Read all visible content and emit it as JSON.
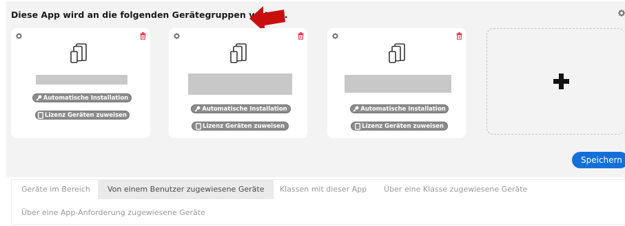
{
  "heading": "Diese App wird an die folgenden Gerätegruppen verteilt.",
  "icons": {
    "settings": "gear-icon",
    "delete": "trash-icon",
    "devices": "devices-icon",
    "key": "key-icon",
    "tablet": "tablet-icon",
    "add": "plus-icon",
    "annotation": "red-arrow"
  },
  "colors": {
    "panel_bg": "#f3f3f4",
    "pill_bg": "#8c8c8c",
    "trash": "#e8394c",
    "save": "#1470d8",
    "arrow": "#c80f0f"
  },
  "cards": [
    {
      "auto_install": "Automatische Installation",
      "assign_license": "Lizenz Geräten zuweisen"
    },
    {
      "auto_install": "Automatische Installation",
      "assign_license": "Lizenz Geräten zuweisen"
    },
    {
      "auto_install": "Automatische Installation",
      "assign_license": "Lizenz Geräten zuweisen"
    }
  ],
  "save_label": "Speichern",
  "tabs": [
    {
      "label": "Geräte im Bereich",
      "active": false
    },
    {
      "label": "Von einem Benutzer zugewiesene Geräte",
      "active": true
    },
    {
      "label": "Klassen mit dieser App",
      "active": false
    },
    {
      "label": "Über eine Klasse zugewiesene Geräte",
      "active": false
    },
    {
      "label": "Über eine App-Anforderung zugewiesene Geräte",
      "active": false
    }
  ]
}
